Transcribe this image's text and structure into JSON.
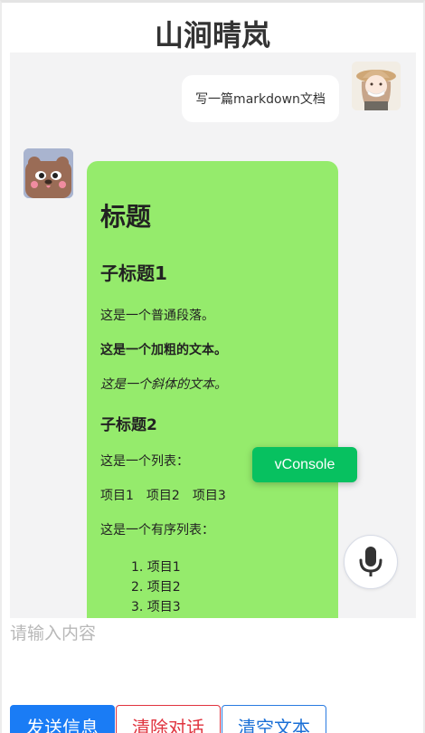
{
  "app": {
    "title": "山涧晴岚"
  },
  "chat": {
    "user_message": "写一篇markdown文档",
    "bot_reply": {
      "h1": "标题",
      "h2": "子标题1",
      "p1": "这是一个普通段落。",
      "p_bold_prefix": "这是一个",
      "p_bold_word": "加粗",
      "p_bold_suffix": "的文本。",
      "p_italic_prefix": "这是一个",
      "p_italic_word": "斜体",
      "p_italic_suffix": "的文本。",
      "h3": "子标题2",
      "list_intro": "这是一个列表：",
      "list_items": [
        "项目1",
        "项目2",
        "项目3"
      ],
      "ordered_intro": "这是一个有序列表：",
      "ordered_items": [
        "1. 项目1",
        "2. 项目2",
        "3. 项目3"
      ]
    }
  },
  "vconsole": {
    "label": "vConsole"
  },
  "composer": {
    "placeholder": "请输入内容",
    "value": ""
  },
  "buttons": {
    "send": "发送信息",
    "clear_chat": "清除对话",
    "clear_text": "清空文本"
  },
  "colors": {
    "bot_bubble": "#95eb6c",
    "chat_bg": "#f3f3f4",
    "send": "#1a7cf5",
    "clear": "#e0343f",
    "vconsole": "#07c160"
  },
  "icons": {
    "mic": "microphone-icon",
    "user_avatar": "user-avatar-icon",
    "bot_avatar": "bear-avatar-icon"
  }
}
